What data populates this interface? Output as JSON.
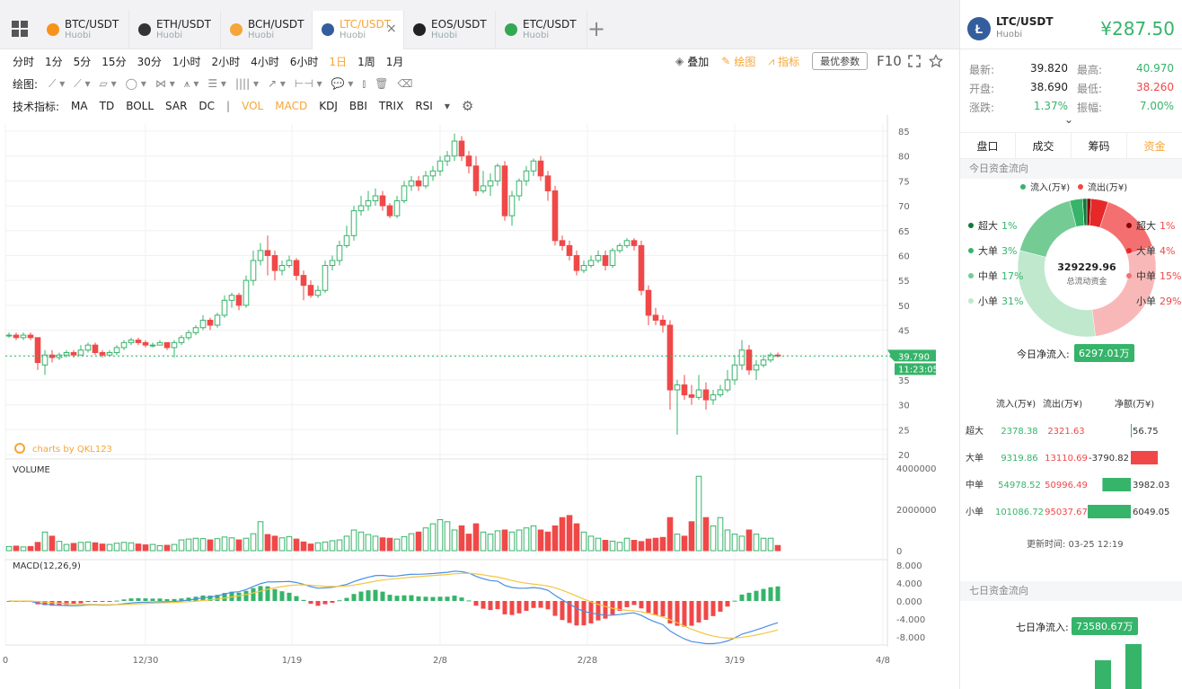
{
  "tabs": [
    {
      "name": "BTC/USDT",
      "exchange": "Huobi",
      "color": "#f7931a",
      "icon": "btc-icon"
    },
    {
      "name": "ETH/USDT",
      "exchange": "Huobi",
      "color": "#333",
      "icon": "eth-icon"
    },
    {
      "name": "BCH/USDT",
      "exchange": "Huobi",
      "color": "#f6a53a",
      "icon": "bch-icon"
    },
    {
      "name": "LTC/USDT",
      "exchange": "Huobi",
      "color": "#345d9d",
      "icon": "ltc-icon",
      "active": true
    },
    {
      "name": "EOS/USDT",
      "exchange": "Huobi",
      "color": "#222",
      "icon": "eos-icon"
    },
    {
      "name": "ETC/USDT",
      "exchange": "Huobi",
      "color": "#33a853",
      "icon": "etc-icon"
    }
  ],
  "periods": [
    "分时",
    "1分",
    "5分",
    "15分",
    "30分",
    "1小时",
    "2小时",
    "4小时",
    "6小时",
    "1日",
    "1周",
    "1月"
  ],
  "active_period": "1日",
  "toolbar": {
    "overlay": "叠加",
    "draw": "绘图",
    "indicator": "指标",
    "best": "最优参数",
    "f10": "F10"
  },
  "draw_label": "绘图:",
  "ind_label": "技术指标:",
  "indicators": [
    "MA",
    "TD",
    "BOLL",
    "SAR",
    "DC",
    "VOL",
    "MACD",
    "KDJ",
    "BBI",
    "TRIX",
    "RSI"
  ],
  "active_indicators": [
    "VOL",
    "MACD"
  ],
  "chart_data": {
    "type": "candlestick",
    "x_ticks": [
      "0",
      "12/30",
      "1/19",
      "2/8",
      "2/28",
      "3/19",
      "4/8"
    ],
    "price_ticks": [
      "85",
      "80",
      "75",
      "70",
      "65",
      "60",
      "55",
      "50",
      "45",
      "40",
      "35",
      "30",
      "25",
      "20"
    ],
    "last_price": "39.790",
    "countdown": "11:23:05",
    "watermark": "charts by QKL123",
    "candles": [
      [
        44,
        44,
        43.5,
        44.5
      ],
      [
        44,
        43.5,
        43,
        44.5
      ],
      [
        43.5,
        44,
        43,
        44.5
      ],
      [
        44,
        43.5,
        43,
        44.5
      ],
      [
        43.5,
        38.5,
        37,
        43.5
      ],
      [
        38,
        40,
        36,
        41
      ],
      [
        40,
        39.5,
        38.5,
        41
      ],
      [
        39.5,
        40,
        39,
        40.5
      ],
      [
        40,
        40.5,
        39.5,
        41
      ],
      [
        40.5,
        40,
        39.5,
        41
      ],
      [
        40,
        41,
        40,
        42
      ],
      [
        41,
        42,
        40.5,
        42.5
      ],
      [
        42,
        40.5,
        40,
        42.5
      ],
      [
        40.5,
        40,
        39.5,
        41
      ],
      [
        40,
        40.5,
        40,
        41
      ],
      [
        40.5,
        41.5,
        40,
        42
      ],
      [
        41.5,
        42.5,
        41,
        43
      ],
      [
        42.5,
        43,
        42,
        43.5
      ],
      [
        43,
        42.5,
        42,
        43.5
      ],
      [
        42.5,
        42,
        41.5,
        43
      ],
      [
        42,
        42,
        41.5,
        42.5
      ],
      [
        42,
        42.5,
        42,
        43
      ],
      [
        42.5,
        41.5,
        41,
        42.5
      ],
      [
        41.5,
        42.5,
        39.5,
        43
      ],
      [
        42.5,
        43.5,
        42,
        44
      ],
      [
        43.5,
        44.5,
        43,
        45
      ],
      [
        44.5,
        45.5,
        44,
        46
      ],
      [
        45.5,
        47,
        45,
        48
      ],
      [
        47,
        46,
        45,
        47.5
      ],
      [
        46,
        48,
        45.5,
        48.5
      ],
      [
        48,
        51,
        47.5,
        52
      ],
      [
        51,
        52,
        49.5,
        52.5
      ],
      [
        52,
        50,
        49,
        52.5
      ],
      [
        50,
        55,
        49.5,
        56
      ],
      [
        55,
        59,
        54,
        61
      ],
      [
        59,
        61,
        58,
        62.5
      ],
      [
        61,
        60,
        56,
        64
      ],
      [
        60,
        57,
        55,
        61
      ],
      [
        57,
        58,
        56,
        59
      ],
      [
        58,
        59,
        57.5,
        60
      ],
      [
        59,
        56,
        55,
        59.5
      ],
      [
        56,
        54,
        51,
        57
      ],
      [
        54,
        52,
        51.5,
        55
      ],
      [
        52,
        53,
        51.5,
        54
      ],
      [
        53,
        58,
        52.5,
        59
      ],
      [
        58,
        59,
        57,
        60
      ],
      [
        59,
        62,
        58,
        63
      ],
      [
        62,
        64,
        61.5,
        66
      ],
      [
        64,
        69,
        63,
        70
      ],
      [
        69,
        70,
        68,
        72
      ],
      [
        70,
        71,
        69,
        73
      ],
      [
        71,
        72,
        70,
        73.5
      ],
      [
        72,
        70,
        69,
        73
      ],
      [
        70,
        68,
        67.5,
        70.5
      ],
      [
        68,
        71,
        67.5,
        72
      ],
      [
        71,
        74,
        70.5,
        75
      ],
      [
        74,
        75,
        73,
        76
      ],
      [
        75,
        74,
        73,
        76
      ],
      [
        74,
        76,
        73.5,
        77
      ],
      [
        76,
        77,
        75,
        78
      ],
      [
        77,
        79,
        76,
        80
      ],
      [
        79,
        80,
        78,
        81
      ],
      [
        80,
        83,
        79,
        84.5
      ],
      [
        83,
        80,
        79,
        84
      ],
      [
        80,
        78,
        76.5,
        81
      ],
      [
        78,
        73,
        72,
        80
      ],
      [
        73,
        74,
        72.5,
        77
      ],
      [
        74,
        75,
        72,
        76.5
      ],
      [
        75,
        78,
        74,
        78.5
      ],
      [
        78,
        68,
        67,
        79
      ],
      [
        68,
        72,
        66,
        73
      ],
      [
        72,
        75,
        71,
        75.5
      ],
      [
        75,
        77,
        74,
        78
      ],
      [
        77,
        79,
        76,
        79.5
      ],
      [
        79,
        76,
        75,
        80
      ],
      [
        76,
        73,
        71,
        77
      ],
      [
        73,
        63,
        62,
        74
      ],
      [
        63,
        62,
        61,
        64
      ],
      [
        62,
        60,
        59,
        63
      ],
      [
        60,
        57,
        56,
        61
      ],
      [
        57,
        58,
        56.5,
        59
      ],
      [
        58,
        59,
        57.5,
        60
      ],
      [
        59,
        60,
        58.5,
        61
      ],
      [
        60,
        58,
        57,
        61
      ],
      [
        58,
        61,
        57.5,
        61.5
      ],
      [
        61,
        62,
        60.5,
        62.5
      ],
      [
        62,
        63,
        61.5,
        63.5
      ],
      [
        63,
        62,
        61,
        63.5
      ],
      [
        62,
        53,
        52,
        63
      ],
      [
        53,
        48,
        46,
        54
      ],
      [
        48,
        47,
        46,
        49.5
      ],
      [
        47,
        46,
        44.5,
        48
      ],
      [
        46,
        33,
        29,
        47
      ],
      [
        33,
        34,
        24,
        35
      ],
      [
        34,
        32,
        31,
        36
      ],
      [
        32,
        31.5,
        30,
        34
      ],
      [
        31.5,
        33,
        31,
        36
      ],
      [
        33,
        31,
        29,
        34.5
      ],
      [
        31,
        32,
        30,
        33
      ],
      [
        32,
        33,
        31.5,
        34
      ],
      [
        33,
        35,
        32.5,
        37
      ],
      [
        35,
        38,
        34,
        40
      ],
      [
        38,
        41,
        37,
        43
      ],
      [
        41,
        37,
        36,
        42
      ],
      [
        37,
        38,
        35,
        39
      ],
      [
        38,
        39,
        37.5,
        40
      ],
      [
        39,
        40,
        38.5,
        40.5
      ],
      [
        40,
        39.8,
        39.5,
        40.5
      ]
    ],
    "volume_ticks": [
      "4000000",
      "2000000",
      "0"
    ],
    "volume": [
      200000,
      220000,
      180000,
      200000,
      400000,
      900000,
      700000,
      450000,
      300000,
      350000,
      400000,
      420000,
      380000,
      320000,
      300000,
      360000,
      400000,
      380000,
      320000,
      280000,
      300000,
      240000,
      260000,
      300000,
      520000,
      560000,
      600000,
      580000,
      520000,
      580000,
      660000,
      620000,
      520000,
      600000,
      820000,
      1400000,
      780000,
      700000,
      620000,
      680000,
      560000,
      420000,
      320000,
      380000,
      420000,
      480000,
      520000,
      700000,
      1000000,
      900000,
      780000,
      700000,
      620000,
      600000,
      560000,
      680000,
      820000,
      900000,
      1100000,
      1300000,
      1500000,
      1400000,
      1000000,
      1200000,
      800000,
      1300000,
      900000,
      800000,
      960000,
      1000000,
      900000,
      1000000,
      1100000,
      1200000,
      1000000,
      900000,
      1200000,
      1600000,
      1700000,
      1300000,
      900000,
      700000,
      600000,
      500000,
      460000,
      400000,
      600000,
      500000,
      440000,
      560000,
      600000,
      640000,
      1600000,
      800000,
      700000,
      1400000,
      3600000,
      1600000,
      1200000,
      1600000,
      1000000,
      800000,
      700000,
      1000000,
      800000,
      600000,
      600000,
      250000
    ],
    "macd_label": "MACD(12,26,9)",
    "macd_ticks": [
      "8.000",
      "4.000",
      "0.000",
      "-4.000",
      "-8.000"
    ]
  },
  "right": {
    "pair": "LTC/USDT",
    "exchange": "Huobi",
    "price": "¥287.50",
    "stats": [
      {
        "k": "最新:",
        "v": "39.820",
        "k2": "最高:",
        "v2": "40.970",
        "c2": "#35b46a"
      },
      {
        "k": "开盘:",
        "v": "38.690",
        "k2": "最低:",
        "v2": "38.260",
        "c2": "#f04848"
      },
      {
        "k": "涨跌:",
        "v": "1.37%",
        "c": "#35b46a",
        "k2": "振幅:",
        "v2": "7.00%",
        "c2": "#35b46a"
      }
    ],
    "tabs": [
      "盘口",
      "成交",
      "筹码",
      "资金"
    ],
    "active_tab": "资金",
    "today_title": "今日资金流向",
    "legend_in": "流入(万¥)",
    "legend_out": "流出(万¥)",
    "donut_total": "329229.96",
    "donut_sub": "总流动资金",
    "in_items": [
      {
        "label": "超大",
        "pct": "1%",
        "color": "#0f7a3a"
      },
      {
        "label": "大单",
        "pct": "3%",
        "color": "#35b46a"
      },
      {
        "label": "中单",
        "pct": "17%",
        "color": "#74cc94"
      },
      {
        "label": "小单",
        "pct": "31%",
        "color": "#bfe8cd"
      }
    ],
    "out_items": [
      {
        "label": "超大",
        "pct": "1%",
        "color": "#8c0000"
      },
      {
        "label": "大单",
        "pct": "4%",
        "color": "#e62828"
      },
      {
        "label": "中单",
        "pct": "15%",
        "color": "#f47070"
      },
      {
        "label": "小单",
        "pct": "29%",
        "color": "#f9b8b8"
      }
    ],
    "net_label": "今日净流入:",
    "net_value": "6297.01万",
    "table_headers": [
      "流入(万¥)",
      "流出(万¥)",
      "净额(万¥)"
    ],
    "table_rows": [
      {
        "label": "超大",
        "in": "2378.38",
        "out": "2321.63",
        "net": "56.75",
        "net_num": 56.75
      },
      {
        "label": "大单",
        "in": "9319.86",
        "out": "13110.69",
        "net": "-3790.82",
        "net_num": -3790.82
      },
      {
        "label": "中单",
        "in": "54978.52",
        "out": "50996.49",
        "net": "3982.03",
        "net_num": 3982.03
      },
      {
        "label": "小单",
        "in": "101086.72",
        "out": "95037.67",
        "net": "6049.05",
        "net_num": 6049.05
      }
    ],
    "update": "更新时间: 03-25 12:19",
    "week_title": "七日资金流向",
    "week_net_label": "七日净流入:",
    "week_net_value": "73580.67万"
  }
}
